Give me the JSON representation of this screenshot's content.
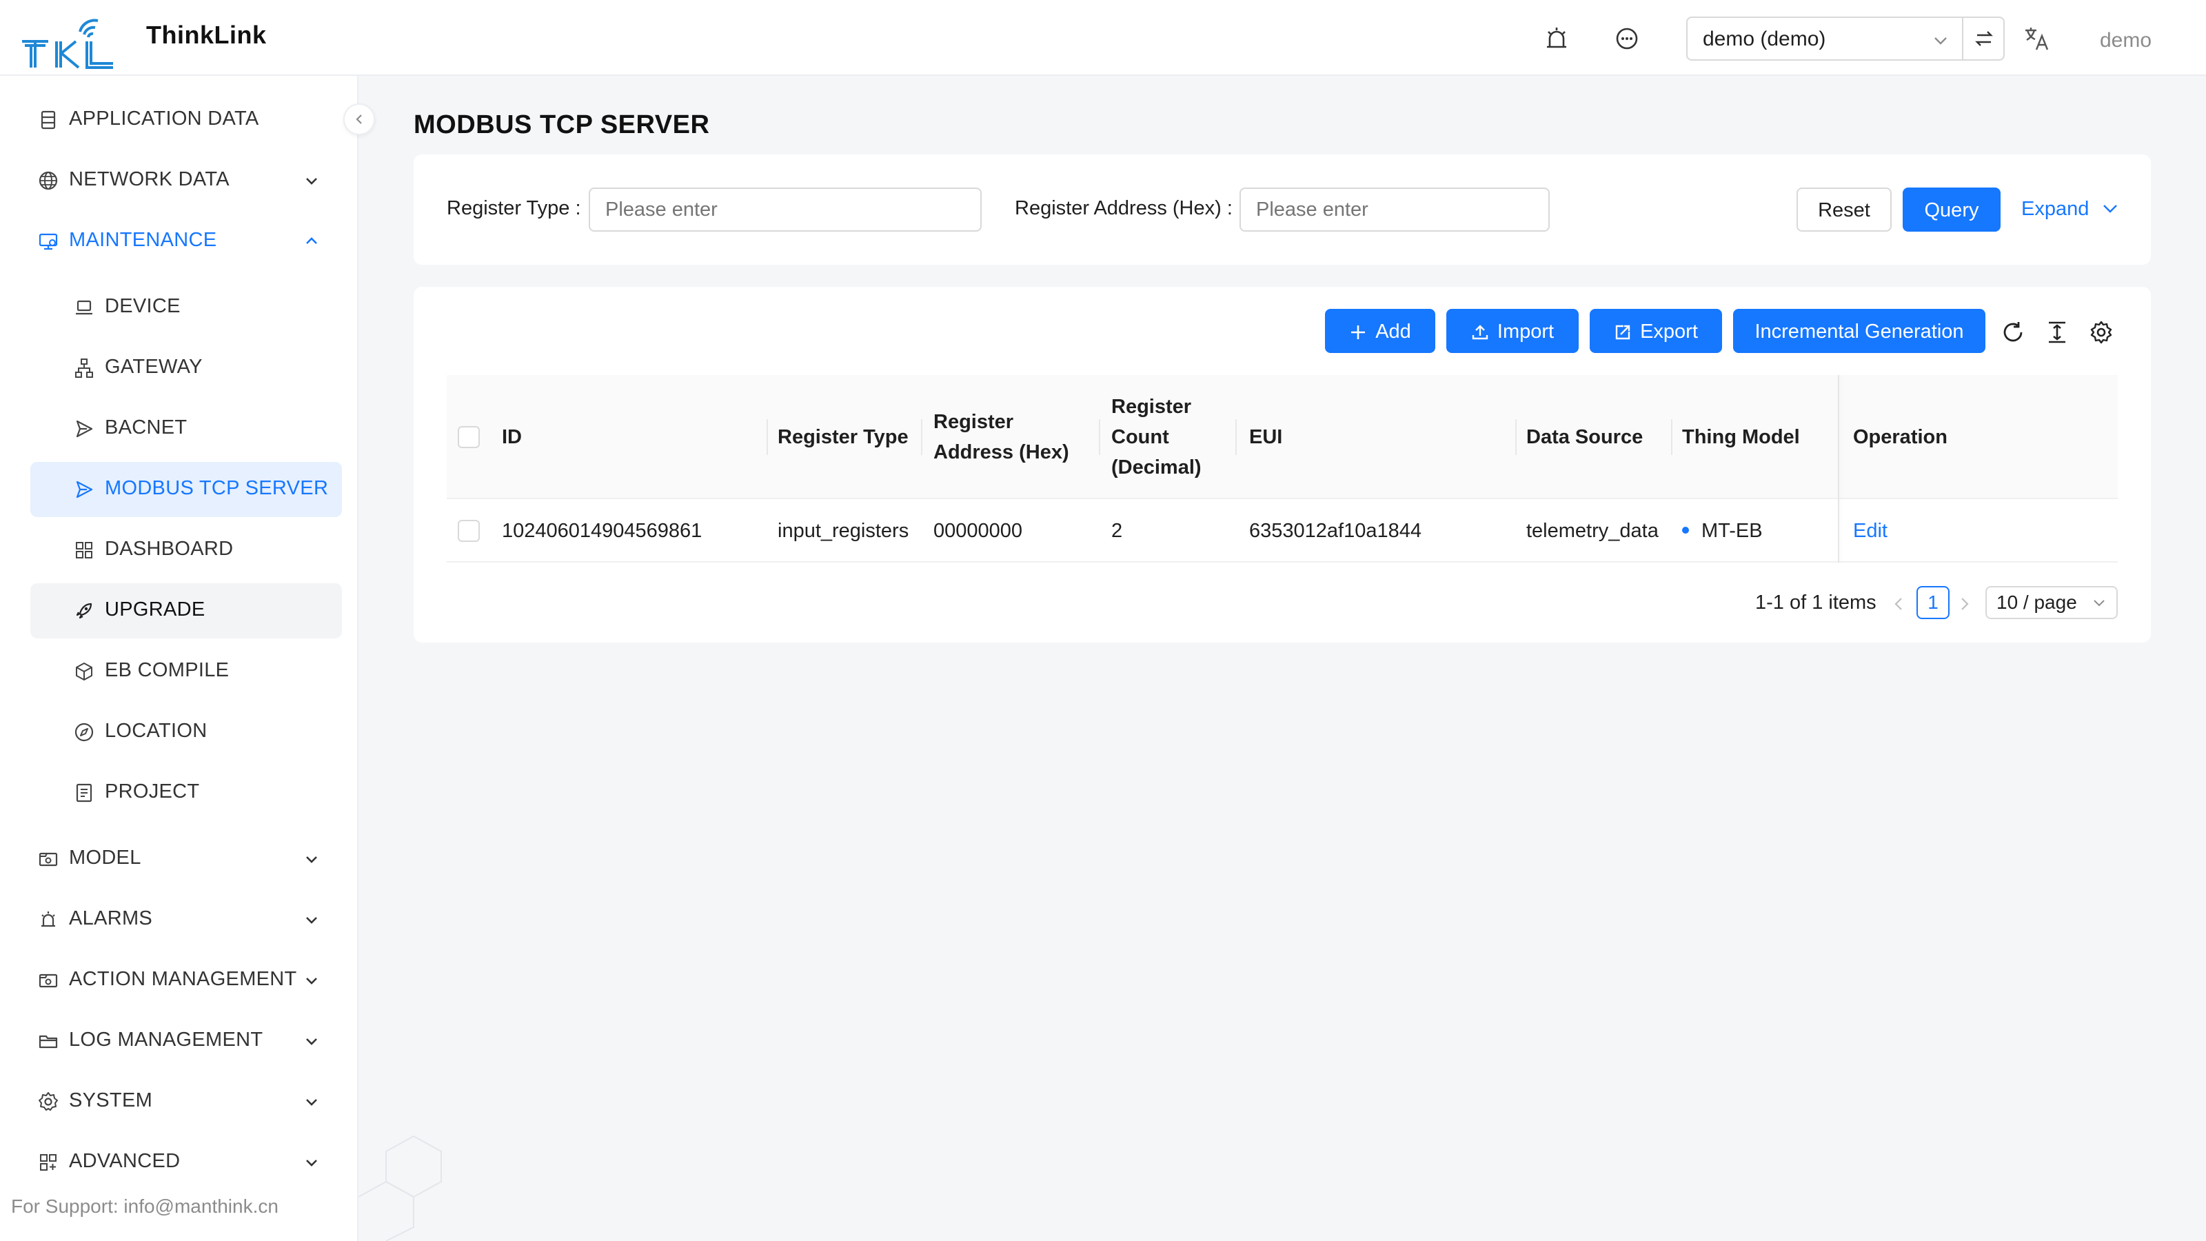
{
  "header": {
    "logo_text": "TKL",
    "brand": "ThinkLink",
    "tenant": "demo (demo)",
    "user": "demo"
  },
  "sidebar": {
    "items": [
      {
        "label": "APPLICATION DATA",
        "icon": "database-icon"
      },
      {
        "label": "NETWORK DATA",
        "icon": "globe-icon"
      },
      {
        "label": "MAINTENANCE",
        "icon": "maintenance-icon"
      },
      {
        "label": "DEVICE",
        "icon": "laptop-icon"
      },
      {
        "label": "GATEWAY",
        "icon": "network-tree-icon"
      },
      {
        "label": "BACNET",
        "icon": "send-icon"
      },
      {
        "label": "MODBUS TCP SERVER",
        "icon": "send-icon"
      },
      {
        "label": "DASHBOARD",
        "icon": "dashboard-icon"
      },
      {
        "label": "UPGRADE",
        "icon": "rocket-icon"
      },
      {
        "label": "EB COMPILE",
        "icon": "cube-icon"
      },
      {
        "label": "LOCATION",
        "icon": "compass-icon"
      },
      {
        "label": "PROJECT",
        "icon": "document-icon"
      },
      {
        "label": "MODEL",
        "icon": "model-icon"
      },
      {
        "label": "ALARMS",
        "icon": "alarm-icon"
      },
      {
        "label": "ACTION MANAGEMENT",
        "icon": "action-icon"
      },
      {
        "label": "LOG MANAGEMENT",
        "icon": "folder-icon"
      },
      {
        "label": "SYSTEM",
        "icon": "gear-icon"
      },
      {
        "label": "ADVANCED",
        "icon": "apps-icon"
      }
    ],
    "support": "For Support: info@manthink.cn"
  },
  "page": {
    "title": "MODBUS TCP SERVER"
  },
  "search": {
    "register_type_label": "Register Type :",
    "register_type_placeholder": "Please enter",
    "register_address_label": "Register Address (Hex) :",
    "register_address_placeholder": "Please enter",
    "reset": "Reset",
    "query": "Query",
    "expand": "Expand"
  },
  "toolbar": {
    "add": "Add",
    "import": "Import",
    "export": "Export",
    "incremental": "Incremental Generation"
  },
  "table": {
    "columns": {
      "id": "ID",
      "register_type": "Register Type",
      "register_address": "Register Address (Hex)",
      "register_count": "Register Count (Decimal)",
      "eui": "EUI",
      "data_source": "Data Source",
      "thing_model": "Thing Model",
      "operation": "Operation"
    },
    "rows": [
      {
        "id": "102406014904569861",
        "register_type": "input_registers",
        "register_address": "00000000",
        "register_count": "2",
        "eui": "6353012af10a1844",
        "data_source": "telemetry_data",
        "thing_model": "MT-EB",
        "operation": "Edit"
      }
    ]
  },
  "pagination": {
    "total": "1-1 of 1 items",
    "current": "1",
    "page_size": "10 / page"
  },
  "colors": {
    "primary": "#1677ff",
    "active_bg": "#e6f0ff",
    "logo": "#1e88d6"
  }
}
